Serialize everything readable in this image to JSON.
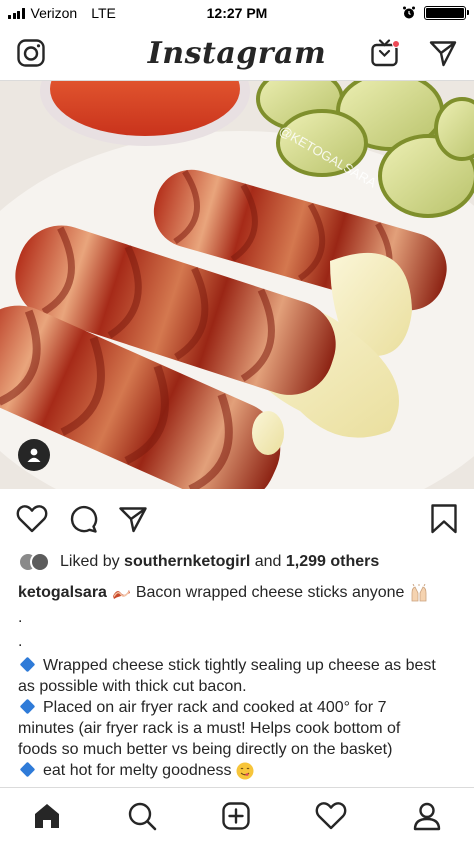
{
  "status_bar": {
    "carrier": "Verizon",
    "network": "LTE",
    "time": "12:27 PM"
  },
  "header": {
    "brand": "Instagram",
    "icons": [
      "camera-icon",
      "igtv-icon",
      "direct-message-icon"
    ],
    "notification_color": "#ed4956"
  },
  "post": {
    "photo_watermark": "@KETOGALSARA",
    "likes": {
      "prefix": "Liked by",
      "user": "southernketogirl",
      "conjunction": "and",
      "others": "1,299 others"
    },
    "caption": {
      "username": "ketogalsara",
      "title": "Bacon wrapped cheese sticks anyone",
      "dot1": ".",
      "dot2": ".",
      "line1": "Wrapped cheese stick tightly sealing up cheese as best as possible with thick cut bacon.",
      "line2": "Placed on air fryer rack and cooked at 400° for 7 minutes (air fryer rack is a must! Helps cook bottom of foods so much better vs being directly on the basket)",
      "line3": "eat hot for melty goodness"
    }
  },
  "bottom_nav": [
    "home-icon",
    "search-icon",
    "new-post-icon",
    "activity-icon",
    "profile-icon"
  ],
  "colors": {
    "text": "#262626",
    "border": "#dbdbdb",
    "bullet": "#2f7bd8"
  }
}
